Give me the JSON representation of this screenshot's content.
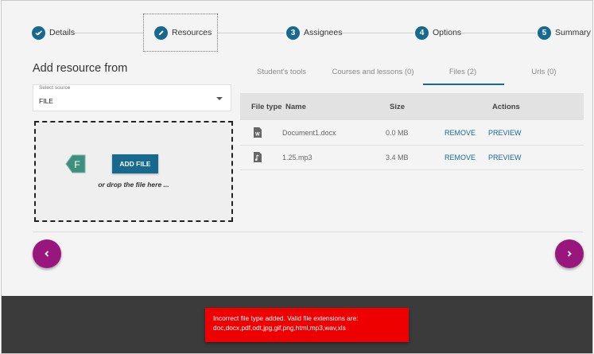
{
  "stepper": {
    "steps": [
      {
        "label": "Details",
        "marker": "check-icon"
      },
      {
        "label": "Resources",
        "marker": "pencil-icon"
      },
      {
        "label": "Assignees",
        "number": "3"
      },
      {
        "label": "Options",
        "number": "4"
      },
      {
        "label": "Summary",
        "number": "5"
      }
    ],
    "active_step": "Resources"
  },
  "left_panel": {
    "title": "Add resource from",
    "source_select": {
      "caption": "Select source",
      "value": "FILE"
    },
    "dropzone": {
      "button_label": "ADD FILE",
      "hint": "or drop the file here ...",
      "marker_letter": "F"
    }
  },
  "tabs": [
    {
      "label": "Student's tools"
    },
    {
      "label": "Courses and lessons (0)"
    },
    {
      "label": "Files (2)",
      "selected": true
    },
    {
      "label": "Urls (0)"
    }
  ],
  "files_table": {
    "headers": {
      "type": "File type",
      "name": "Name",
      "size": "Size",
      "actions": "Actions"
    },
    "rows": [
      {
        "icon": "word-document-icon",
        "name": "Document1.docx",
        "size": "0.0 MB",
        "remove": "REMOVE",
        "preview": "PREVIEW"
      },
      {
        "icon": "audio-file-icon",
        "name": "1.25.mp3",
        "size": "3.4 MB",
        "remove": "REMOVE",
        "preview": "PREVIEW"
      }
    ]
  },
  "navigation": {
    "prev_icon": "chevron-left-icon",
    "next_icon": "chevron-right-icon"
  },
  "toast": {
    "message": "Incorrect file type added. Valid file extensions are: doc,docx,pdf,odt,jpg,gif,png,html,mp3,wav,xls"
  },
  "colors": {
    "accent": "#17698f",
    "nav_button": "#98167e",
    "error": "#ee0000",
    "footer": "#3b3b3b"
  }
}
